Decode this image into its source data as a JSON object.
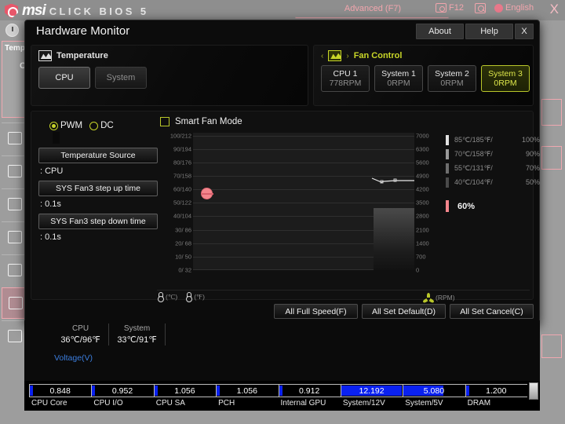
{
  "bios": {
    "brand": "msi",
    "product": "CLICK BIOS 5",
    "advanced_label": "Advanced (F7)",
    "screenshot_key": "F12",
    "language": "English",
    "close_label": "X",
    "sidebar_temp_label": "Temp",
    "sidebar_temp_value": "C"
  },
  "dialog": {
    "title": "Hardware Monitor",
    "buttons": {
      "about": "About",
      "help": "Help",
      "close": "X"
    }
  },
  "temperature_panel": {
    "header": "Temperature",
    "icon": "chart-icon",
    "tabs": [
      {
        "label": "CPU",
        "active": true
      },
      {
        "label": "System",
        "active": false
      }
    ]
  },
  "fan_control_panel": {
    "header": "Fan Control",
    "icon": "fan-chart-icon",
    "prev_arrow": "‹",
    "next_arrow": "›",
    "fans": [
      {
        "name": "CPU 1",
        "rpm": "778RPM",
        "selected": false
      },
      {
        "name": "System 1",
        "rpm": "0RPM",
        "selected": false
      },
      {
        "name": "System 2",
        "rpm": "0RPM",
        "selected": false
      },
      {
        "name": "System 3",
        "rpm": "0RPM",
        "selected": true
      }
    ]
  },
  "controls": {
    "mode_pwm": "PWM",
    "mode_dc": "DC",
    "mode_selected": "PWM",
    "temperature_source_label": "Temperature Source",
    "temperature_source_value": ": CPU",
    "step_up_label": "SYS Fan3 step up time",
    "step_up_value": ": 0.1s",
    "step_down_label": "SYS Fan3 step down time",
    "step_down_value": ": 0.1s",
    "smart_fan_mode_label": "Smart Fan Mode",
    "smart_fan_mode_checked": false
  },
  "chart_data": {
    "type": "line",
    "title": "Smart Fan Mode curve",
    "xlabel": "",
    "ylabel_left": "Temperature (°C / °F)",
    "ylabel_right": "Fan speed (RPM)",
    "grid": true,
    "y_left_ticks": [
      "100/212",
      "90/194",
      "80/176",
      "70/158",
      "60/140",
      "50/122",
      "40/104",
      "30/ 86",
      "20/ 68",
      "10/ 50",
      "0/ 32"
    ],
    "y_right_ticks": [
      "7000",
      "6300",
      "5600",
      "4900",
      "4200",
      "3500",
      "2800",
      "2100",
      "1400",
      "700",
      "0"
    ],
    "ylim_left": [
      0,
      100
    ],
    "ylim_right": [
      0,
      7000
    ],
    "current_temp_marker": {
      "value_c": 60,
      "value_f": 140,
      "color": "#f4868d"
    },
    "fan_curve_points": [
      {
        "temp_c": 40,
        "percent": 50
      },
      {
        "temp_c": 55,
        "percent": 70
      },
      {
        "temp_c": 70,
        "percent": 90
      },
      {
        "temp_c": 85,
        "percent": 100
      }
    ],
    "axis_units": {
      "celsius": "(℃)",
      "fahrenheit": "(℉)",
      "rpm": "(RPM)"
    }
  },
  "legend": {
    "rows": [
      {
        "temp": "85℃/185℉/",
        "pct": "100%",
        "color": "#e0e0e0"
      },
      {
        "temp": "70℃/158℉/",
        "pct": "90%",
        "color": "#9a9a9a"
      },
      {
        "temp": "55℃/131℉/",
        "pct": "70%",
        "color": "#6e6e6e"
      },
      {
        "temp": "40℃/104℉/",
        "pct": "50%",
        "color": "#4a4a4a"
      }
    ],
    "current_value": "60%",
    "current_color": "#f4868d"
  },
  "action_buttons": [
    {
      "label": "All Full Speed(F)"
    },
    {
      "label": "All Set Default(D)"
    },
    {
      "label": "All Set Cancel(C)"
    }
  ],
  "status_bar": {
    "temps": [
      {
        "name": "CPU",
        "value": "36℃/96℉"
      },
      {
        "name": "System",
        "value": "33℃/91℉"
      }
    ],
    "voltage_header": "Voltage(V)"
  },
  "voltages": [
    {
      "label": "CPU Core",
      "value": "0.848",
      "fill_pct": 4,
      "highlight": false
    },
    {
      "label": "CPU I/O",
      "value": "0.952",
      "fill_pct": 4,
      "highlight": false
    },
    {
      "label": "CPU SA",
      "value": "1.056",
      "fill_pct": 4,
      "highlight": false
    },
    {
      "label": "PCH",
      "value": "1.056",
      "fill_pct": 4,
      "highlight": false
    },
    {
      "label": "Internal GPU",
      "value": "0.912",
      "fill_pct": 4,
      "highlight": false
    },
    {
      "label": "System/12V",
      "value": "12.192",
      "fill_pct": 100,
      "highlight": true
    },
    {
      "label": "System/5V",
      "value": "5.080",
      "fill_pct": 64,
      "highlight": true
    },
    {
      "label": "DRAM",
      "value": "1.200",
      "fill_pct": 4,
      "highlight": false
    }
  ],
  "colors": {
    "accent_green": "#c6d32a",
    "accent_pink": "#f4868d",
    "voltage_blue": "#0a21f0",
    "link_blue": "#3b7ddd"
  }
}
